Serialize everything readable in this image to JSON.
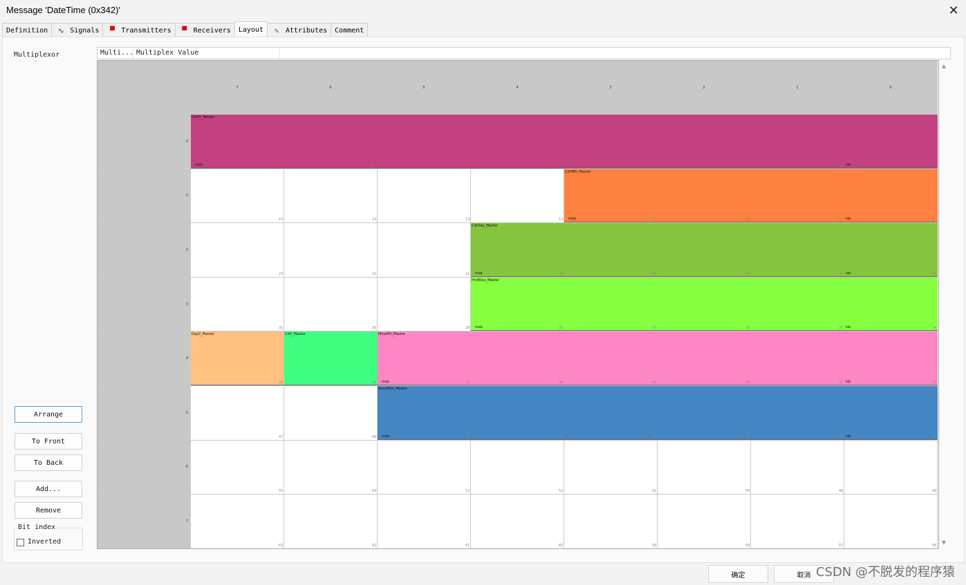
{
  "window": {
    "title": "Message 'DateTime (0x342)'"
  },
  "tabs": [
    {
      "label": "Definition",
      "icon": ""
    },
    {
      "label": "Signals",
      "icon": "signal-wave-icon"
    },
    {
      "label": "Transmitters",
      "icon": "red-node-icon"
    },
    {
      "label": "Receivers",
      "icon": "red-node-icon"
    },
    {
      "label": "Layout",
      "icon": ""
    },
    {
      "label": "Attributes",
      "icon": "pencil-icon"
    },
    {
      "label": "Comment",
      "icon": ""
    }
  ],
  "active_tab": 4,
  "multiplexor": {
    "label": "Multiplexor Signal:",
    "col1": "Multi...",
    "col2": "Multiplex Value"
  },
  "grid": {
    "col_headers": [
      "7",
      "6",
      "5",
      "4",
      "3",
      "2",
      "1",
      "0"
    ],
    "row_headers": [
      "0",
      "1",
      "2",
      "3",
      "4",
      "5",
      "6",
      "7"
    ],
    "signals": [
      {
        "name": "CdrYr_Master",
        "row": 0,
        "msbCol": 0,
        "lsbCol": 7,
        "color": "#c44182",
        "msbLabel": "msb",
        "lsbLabel": "lsb"
      },
      {
        "name": "CdrMth_Master",
        "row": 1,
        "msbCol": 4,
        "lsbCol": 7,
        "color": "#ff8040",
        "msbLabel": "msb",
        "lsbLabel": "lsb"
      },
      {
        "name": "CdrDay_Master",
        "row": 2,
        "msbCol": 3,
        "lsbCol": 7,
        "color": "#86c440",
        "msbLabel": "msb",
        "lsbLabel": "lsb"
      },
      {
        "name": "HrofDay_Master",
        "row": 3,
        "msbCol": 3,
        "lsbCol": 7,
        "color": "#86ff40",
        "msbLabel": "msb",
        "lsbLabel": "lsb"
      },
      {
        "name": "DayV_Master",
        "row": 4,
        "msbCol": 0,
        "lsbCol": 0,
        "color": "#ffc080",
        "msbLabel": "",
        "lsbLabel": ""
      },
      {
        "name": "CdV_Master",
        "row": 4,
        "msbCol": 1,
        "lsbCol": 1,
        "color": "#40ff80",
        "msbLabel": "",
        "lsbLabel": ""
      },
      {
        "name": "MinofHr_Master",
        "row": 4,
        "msbCol": 2,
        "lsbCol": 7,
        "color": "#ff86c4",
        "msbLabel": "msb",
        "lsbLabel": "lsb"
      },
      {
        "name": "SecofMin_Master",
        "row": 5,
        "msbCol": 2,
        "lsbCol": 7,
        "color": "#4486c4",
        "msbLabel": "msb",
        "lsbLabel": "lsb"
      }
    ]
  },
  "buttons": {
    "arrange": "Arrange",
    "to_front": "To Front",
    "to_back": "To Back",
    "add": "Add...",
    "remove": "Remove"
  },
  "bit_index": {
    "label": "Bit index",
    "inverted_label": "Inverted",
    "inverted_checked": false
  },
  "footer": {
    "ok": "确定",
    "cancel": "取消"
  },
  "watermark": "CSDN @不脱发的程序猿"
}
